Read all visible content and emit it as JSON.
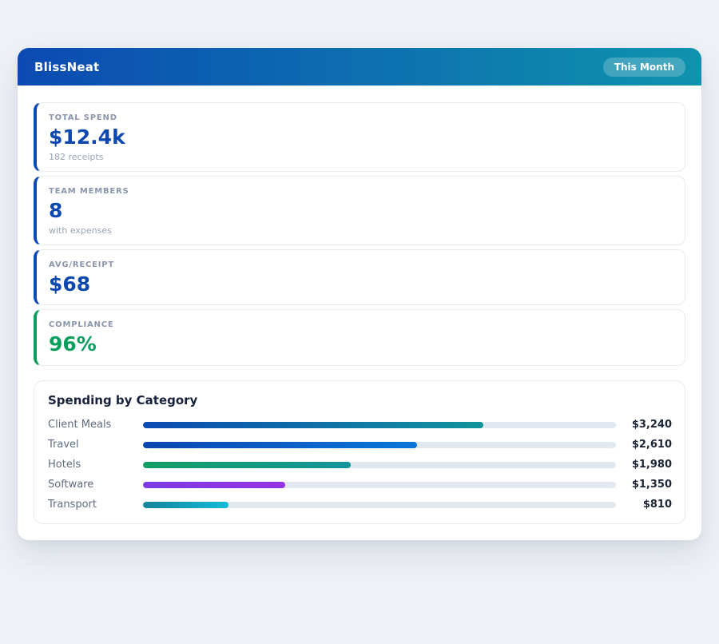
{
  "page": {
    "background_color": "#eef1f6"
  },
  "header": {
    "title": "BlissNeat",
    "badge": "This Month",
    "gradient_start": "#0b4ab3",
    "gradient_end": "#0f93ad"
  },
  "stats": [
    {
      "label": "TOTAL SPEND",
      "value": "$12.4k",
      "sub": "182 receipts",
      "accent": "#0b4ab3",
      "value_color": "#0d47b0"
    },
    {
      "label": "TEAM MEMBERS",
      "value": "8",
      "sub": "with expenses",
      "accent": "#0b4ab3",
      "value_color": "#0d47b0"
    },
    {
      "label": "AVG/RECEIPT",
      "value": "$68",
      "sub": "",
      "accent": "#0b4ab3",
      "value_color": "#0d47b0"
    },
    {
      "label": "COMPLIANCE",
      "value": "96%",
      "sub": "",
      "accent": "#0a9e5c",
      "value_color": "#0a9e5c"
    }
  ],
  "chart": {
    "title": "Spending by Category"
  },
  "chart_data": {
    "type": "bar",
    "orientation": "horizontal",
    "title": "Spending by Category",
    "categories": [
      "Client Meals",
      "Travel",
      "Hotels",
      "Software",
      "Transport"
    ],
    "values": [
      3240,
      2610,
      1980,
      1350,
      810
    ],
    "value_labels": [
      "$3,240",
      "$2,610",
      "$1,980",
      "$1,350",
      "$810"
    ],
    "xlim": [
      0,
      4500
    ],
    "grid": false,
    "legend": "none",
    "track_color": "#e2e8f0",
    "bar_gradients": [
      [
        "#0b4ab2",
        "#12949c"
      ],
      [
        "#0a47b0",
        "#0b76d8"
      ],
      [
        "#0d9e62",
        "#12959c"
      ],
      [
        "#7d3be4",
        "#9631e2"
      ],
      [
        "#15839b",
        "#13bcd9"
      ]
    ]
  }
}
